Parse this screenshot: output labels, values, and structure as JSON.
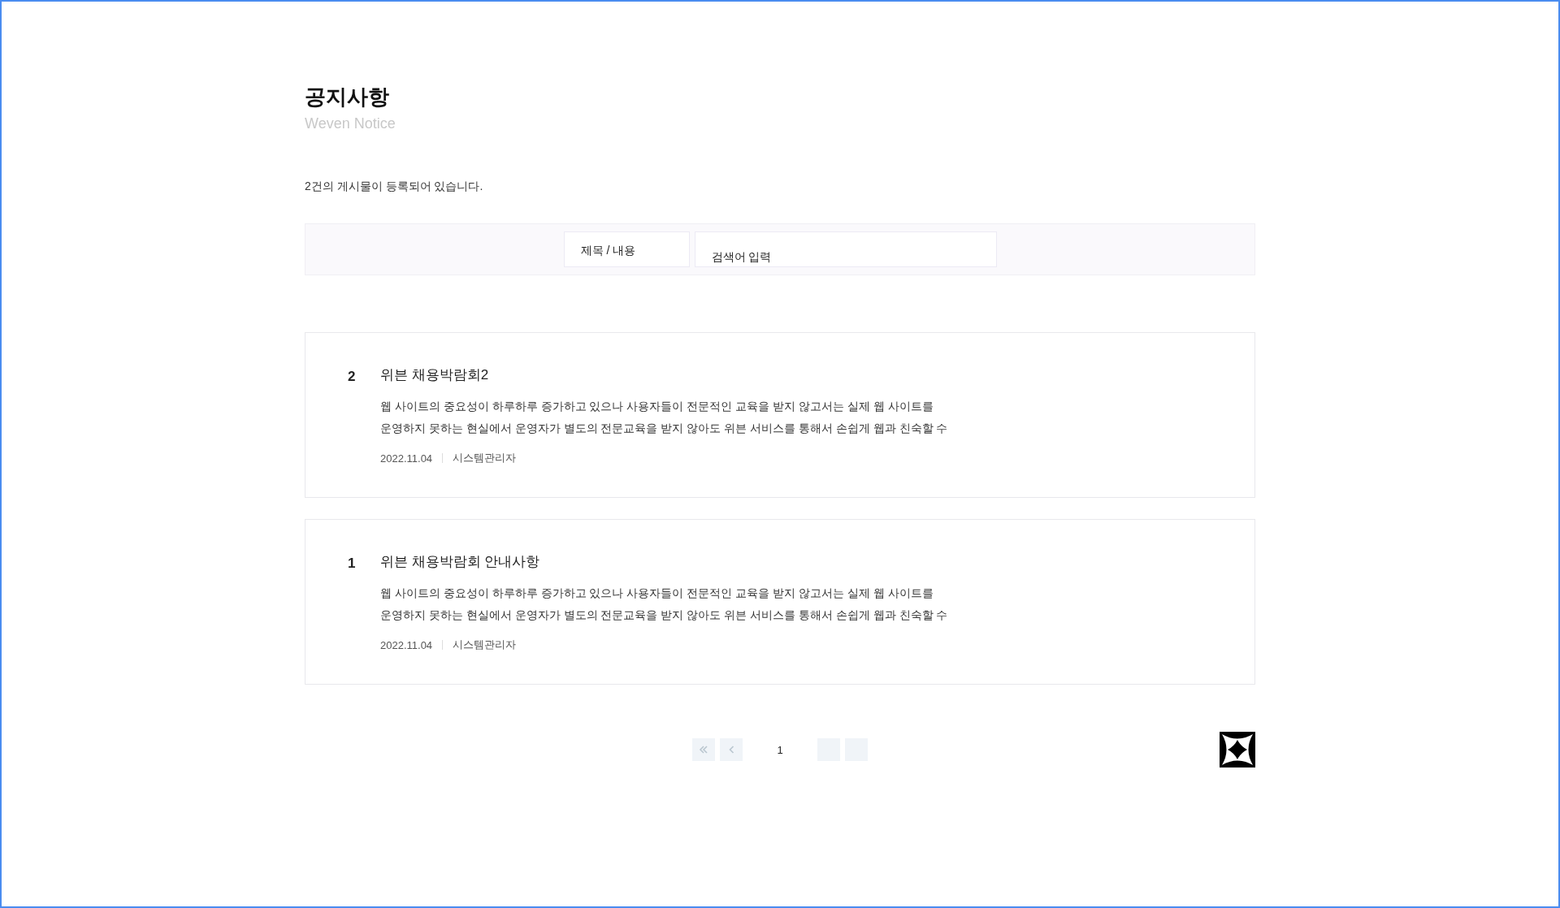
{
  "header": {
    "title": "공지사항",
    "subtitle": "Weven Notice"
  },
  "count_text": "2건의 게시물이 등록되어 있습니다.",
  "search": {
    "select": "제목 / 내용",
    "placeholder": "검색어 입력"
  },
  "posts": [
    {
      "number": "2",
      "title": "위븐 채용박람회2",
      "lines": [
        "웹 사이트의 중요성이 하루하루 증가하고 있으나 사용자들이 전문적인 교육을 받지 않고서는 실제 웹 사이트를",
        "운영하지 못하는 현실에서 운영자가 별도의 전문교육을 받지 않아도 위븐 서비스를 통해서 손쉽게 웹과 친숙할 수"
      ],
      "date": "2022.11.04",
      "author": "시스템관리자"
    },
    {
      "number": "1",
      "title": "위븐 채용박람회 안내사항",
      "lines": [
        "웹 사이트의 중요성이 하루하루 증가하고 있으나 사용자들이 전문적인 교육을 받지 않고서는 실제 웹 사이트를",
        "운영하지 못하는 현실에서 운영자가 별도의 전문교육을 받지 않아도 위븐 서비스를 통해서 손쉽게 웹과 친숙할 수"
      ],
      "date": "2022.11.04",
      "author": "시스템관리자"
    }
  ],
  "pagination": {
    "pages": [
      {
        "label": "1",
        "selected": true
      }
    ]
  }
}
